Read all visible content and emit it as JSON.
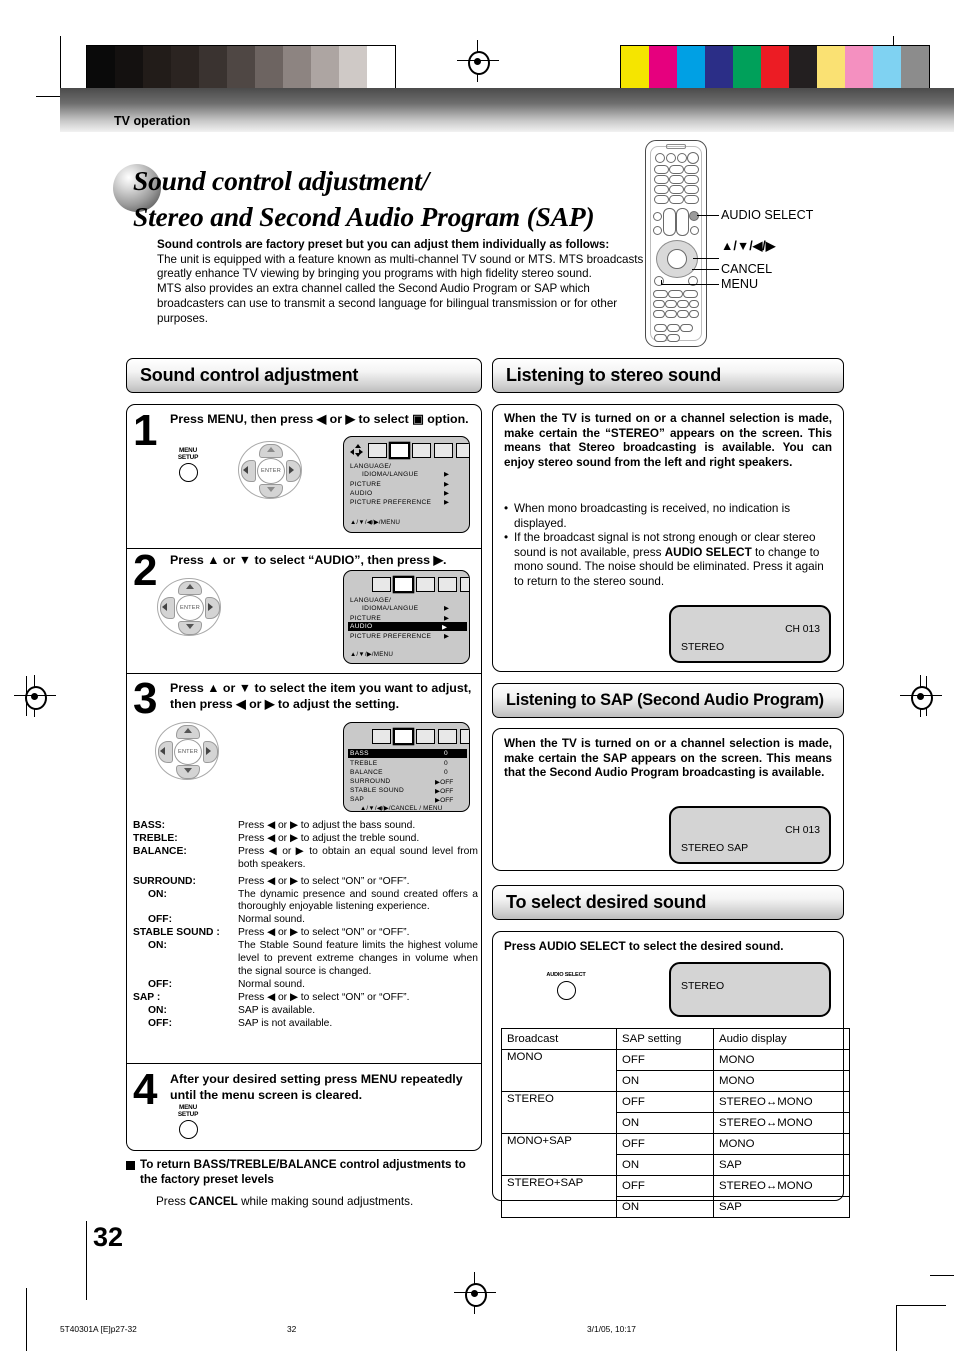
{
  "page": {
    "running_head": "TV operation",
    "title_line1": "Sound control adjustment/",
    "title_line2": "Stereo and Second Audio Program (SAP)",
    "number": "32"
  },
  "intro": {
    "lead": "Sound controls are factory preset but you can adjust them individually as follows:",
    "p1": "The unit is equipped with a feature known as multi-channel TV sound or MTS. MTS broadcasts greatly enhance TV viewing by bringing you programs with high fidelity stereo sound.",
    "p2": "MTS also provides an extra channel called the Second Audio Program or SAP which broadcasters can use to transmit a second language for bilingual transmission or for other purposes."
  },
  "remote": {
    "callouts": [
      "AUDIO SELECT",
      "▲/▼/◀/▶",
      "CANCEL",
      "MENU"
    ]
  },
  "sections": {
    "sound_control": "Sound control adjustment",
    "stereo": "Listening to stereo sound",
    "sap": "Listening to SAP (Second Audio Program)",
    "select": "To select desired sound"
  },
  "steps": [
    {
      "num": "1",
      "text": "Press MENU, then press ◀ or ▶ to select ▣ option.",
      "button_label": "MENU\nSETUP"
    },
    {
      "num": "2",
      "text": "Press ▲ or ▼ to select “AUDIO”, then press ▶."
    },
    {
      "num": "3",
      "text": "Press ▲ or ▼ to select the item you want to adjust, then press ◀ or ▶ to adjust the setting."
    },
    {
      "num": "4",
      "text": "After your desired setting press MENU repeatedly until the menu screen is cleared.",
      "button_label": "MENU\nSETUP"
    }
  ],
  "osd_main": {
    "items": [
      "LANGUAGE/",
      "IDIOMA/LANGUE",
      "PICTURE",
      "AUDIO",
      "PICTURE  PREFERENCE"
    ],
    "arrow": "▶",
    "footer": "▲/▼/◀/▶/MENU",
    "footer2": "▲/▼/▶/MENU",
    "highlight": "AUDIO"
  },
  "osd_audio": {
    "rows": [
      {
        "label": "BASS",
        "value": "0"
      },
      {
        "label": "TREBLE",
        "value": "0"
      },
      {
        "label": "BALANCE",
        "value": "0"
      },
      {
        "label": "SURROUND",
        "value": "▶OFF"
      },
      {
        "label": "STABLE SOUND",
        "value": "▶OFF"
      },
      {
        "label": "SAP",
        "value": "▶OFF"
      }
    ],
    "footer": "▲/▼/◀/▶/CANCEL / MENU"
  },
  "enter_label": "ENTER",
  "definitions": [
    {
      "term": "BASS:",
      "desc": "Press ◀ or ▶ to adjust the bass sound.",
      "indent": 0
    },
    {
      "term": "TREBLE:",
      "desc": "Press ◀ or ▶ to adjust the treble sound.",
      "indent": 0
    },
    {
      "term": "BALANCE:",
      "desc": "Press ◀ or ▶ to obtain an equal sound level from both speakers.",
      "indent": 0
    },
    {
      "term": "SURROUND:",
      "desc": "Press ◀ or ▶ to select “ON” or “OFF”.",
      "indent": 0
    },
    {
      "term": "ON:",
      "desc": "The dynamic presence and sound created offers a thoroughly enjoyable listening experience.",
      "indent": 1
    },
    {
      "term": "OFF:",
      "desc": "Normal sound.",
      "indent": 1
    },
    {
      "term": "STABLE SOUND :",
      "desc": "Press ◀ or ▶ to select “ON” or “OFF”.",
      "indent": 0
    },
    {
      "term": "ON:",
      "desc": "The Stable Sound feature limits the highest volume level to prevent extreme changes in volume when the signal source is changed.",
      "indent": 1
    },
    {
      "term": "OFF:",
      "desc": "Normal sound.",
      "indent": 1
    },
    {
      "term": "SAP :",
      "desc": "Press ◀ or ▶ to select “ON” or “OFF”.",
      "indent": 0
    },
    {
      "term": "ON:",
      "desc": "SAP is available.",
      "indent": 1
    },
    {
      "term": "OFF:",
      "desc": "SAP is not available.",
      "indent": 1
    }
  ],
  "footnote": {
    "heading": "To return BASS/TREBLE/BALANCE control adjustments to the factory preset levels",
    "body_pre": "Press ",
    "body_bold": "CANCEL",
    "body_post": " while making sound adjustments."
  },
  "stereo_section": {
    "body": "When the TV is turned on or a channel selection is made, make certain the “STEREO” appears on the screen. This means that Stereo broadcasting is available. You can enjoy stereo sound from the left and right speakers.",
    "bullet1": "When mono broadcasting is received, no indication is displayed.",
    "bullet2_pre": "If the broadcast signal is not strong enough or clear stereo sound is not available, press ",
    "bullet2_bold": "AUDIO SELECT",
    "bullet2_post": " to change to mono sound. The noise should be eliminated. Press it again to return to the stereo sound.",
    "screen_ch": "CH 013",
    "screen_status": "STEREO"
  },
  "sap_section": {
    "body": "When the TV is turned on or a channel selection is made, make certain the SAP appears on the screen. This means that the Second Audio Program broadcasting is available.",
    "screen_ch": "CH 013",
    "screen_status": "STEREO  SAP"
  },
  "select_section": {
    "instruction": "Press AUDIO SELECT to select the desired sound.",
    "button_label": "AUDIO SELECT",
    "screen_status": "STEREO"
  },
  "audio_table": {
    "headers": [
      "Broadcast",
      "SAP setting",
      "Audio display"
    ],
    "rows": [
      {
        "broadcast": "MONO",
        "settings": [
          {
            "sap": "OFF",
            "display": "MONO"
          },
          {
            "sap": "ON",
            "display": "MONO"
          }
        ]
      },
      {
        "broadcast": "STEREO",
        "settings": [
          {
            "sap": "OFF",
            "display": "STEREO↔MONO"
          },
          {
            "sap": "ON",
            "display": "STEREO↔MONO"
          }
        ]
      },
      {
        "broadcast": "MONO+SAP",
        "settings": [
          {
            "sap": "OFF",
            "display": "MONO"
          },
          {
            "sap": "ON",
            "display": "SAP"
          }
        ]
      },
      {
        "broadcast": "STEREO+SAP",
        "settings": [
          {
            "sap": "OFF",
            "display": "STEREO↔MONO"
          },
          {
            "sap": "ON",
            "display": "SAP"
          }
        ]
      }
    ]
  },
  "print_footer": {
    "left": "5T40301A [E]p27-32",
    "center": "32",
    "right": "3/1/05, 10:17"
  },
  "reg_marks": {
    "gray_ramp": [
      "#0a0a0a",
      "#141110",
      "#221c19",
      "#2b2421",
      "#3a3330",
      "#4f4744",
      "#6d6461",
      "#8d8481",
      "#ada5a2",
      "#cfc9c6",
      "#ffffff"
    ],
    "colors": [
      "#f5e500",
      "#e6007e",
      "#00a0e4",
      "#2b2e87",
      "#00a05a",
      "#ec1c24",
      "#231f20",
      "#fae173",
      "#f490c0",
      "#7fd2f2",
      "#8c8c8c"
    ]
  }
}
